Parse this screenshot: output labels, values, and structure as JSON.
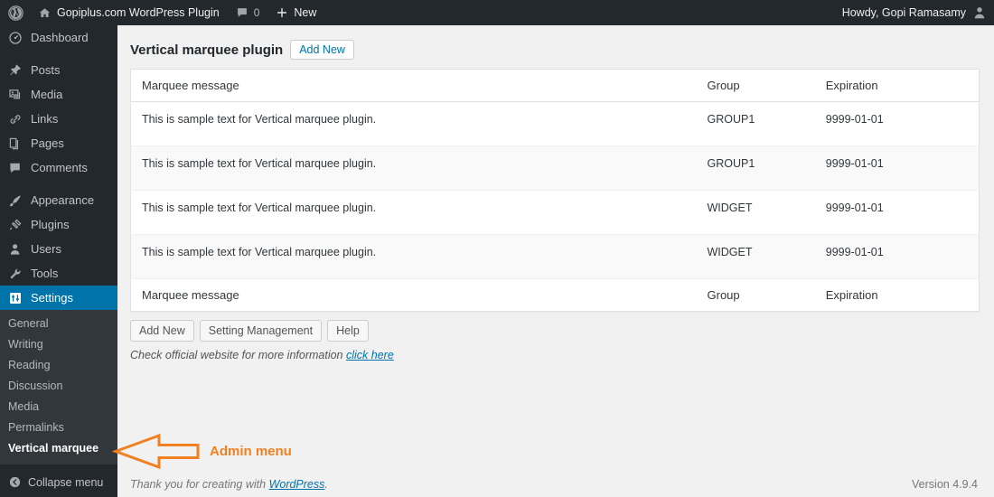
{
  "adminbar": {
    "logo_icon": "wordpress-logo-icon",
    "home_icon": "home-icon",
    "site_name": "Gopiplus.com WordPress Plugin",
    "comments_icon": "comment-bubble-icon",
    "comments_count": "0",
    "new_icon": "plus-icon",
    "new_label": "New",
    "howdy": "Howdy, Gopi Ramasamy",
    "avatar_icon": "user-avatar-icon"
  },
  "sidebar": {
    "items": [
      {
        "label": "Dashboard",
        "icon": "dashboard-gauge-icon"
      },
      {
        "label": "Posts",
        "icon": "pin-icon"
      },
      {
        "label": "Media",
        "icon": "media-icon"
      },
      {
        "label": "Links",
        "icon": "link-chain-icon"
      },
      {
        "label": "Pages",
        "icon": "pages-icon"
      },
      {
        "label": "Comments",
        "icon": "comment-bubble-icon"
      },
      {
        "label": "Appearance",
        "icon": "paintbrush-icon"
      },
      {
        "label": "Plugins",
        "icon": "plug-icon"
      },
      {
        "label": "Users",
        "icon": "user-icon"
      },
      {
        "label": "Tools",
        "icon": "wrench-icon"
      },
      {
        "label": "Settings",
        "icon": "settings-sliders-icon"
      }
    ],
    "submenu": [
      {
        "label": "General"
      },
      {
        "label": "Writing"
      },
      {
        "label": "Reading"
      },
      {
        "label": "Discussion"
      },
      {
        "label": "Media"
      },
      {
        "label": "Permalinks"
      },
      {
        "label": "Vertical marquee"
      }
    ],
    "collapse": {
      "label": "Collapse menu",
      "icon": "collapse-arrow-left-icon"
    }
  },
  "page": {
    "title": "Vertical marquee plugin",
    "add_new_button": "Add New"
  },
  "table": {
    "columns": [
      "Marquee message",
      "Group",
      "Expiration"
    ],
    "rows": [
      {
        "message": "This is sample text for Vertical marquee plugin.",
        "group": "GROUP1",
        "expiration": "9999-01-01"
      },
      {
        "message": "This is sample text for Vertical marquee plugin.",
        "group": "GROUP1",
        "expiration": "9999-01-01"
      },
      {
        "message": "This is sample text for Vertical marquee plugin.",
        "group": "WIDGET",
        "expiration": "9999-01-01"
      },
      {
        "message": "This is sample text for Vertical marquee plugin.",
        "group": "WIDGET",
        "expiration": "9999-01-01"
      }
    ]
  },
  "actions": {
    "add_new": "Add New",
    "setting_management": "Setting Management",
    "help": "Help"
  },
  "note": {
    "text": "Check official website for more information",
    "link": "click here"
  },
  "footer": {
    "thanks_prefix": "Thank you for creating with",
    "thanks_link": "WordPress",
    "thanks_suffix": ".",
    "version": "Version 4.9.4"
  },
  "annotation": {
    "label": "Admin menu",
    "color": "#f08020",
    "arrow_icon": "arrow-left-annotation-icon"
  },
  "colors": {
    "adminbar": "#23282d",
    "sidebar": "#23282d",
    "submenu": "#32373c",
    "current_blue": "#0073aa",
    "content_bg": "#f1f1f1",
    "annotation_orange": "#f08020"
  }
}
